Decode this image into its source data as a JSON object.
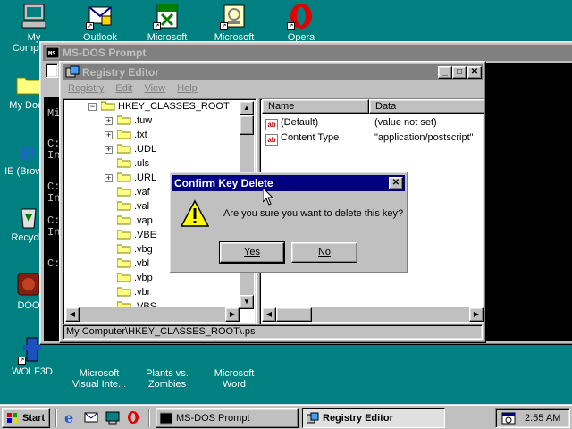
{
  "desktop": {
    "icons": [
      {
        "label": "My Computer"
      },
      {
        "label": "Outlook"
      },
      {
        "label": "Microsoft"
      },
      {
        "label": "Microsoft"
      },
      {
        "label": "Opera"
      },
      {
        "label": "My Docu"
      },
      {
        "label": "IE (Browse"
      },
      {
        "label": "Recycle"
      },
      {
        "label": "DOO"
      },
      {
        "label": "WOLF3D"
      },
      {
        "label": "Microsoft Visual Inte..."
      },
      {
        "label": "Plants vs. Zombies"
      },
      {
        "label": "Microsoft Word"
      }
    ]
  },
  "dos_window": {
    "title": "MS-DOS Prompt",
    "lines": [
      "Mi",
      "C:",
      "In",
      "C:",
      "In",
      "C:",
      "In",
      "C:"
    ]
  },
  "regedit": {
    "title": "Registry Editor",
    "menu": [
      "Registry",
      "Edit",
      "View",
      "Help"
    ],
    "tree_root": "HKEY_CLASSES_ROOT",
    "tree_items": [
      {
        "label": ".tuw",
        "expandable": true
      },
      {
        "label": ".txt",
        "expandable": true
      },
      {
        "label": ".UDL",
        "expandable": true
      },
      {
        "label": ".uls",
        "expandable": false
      },
      {
        "label": ".URL",
        "expandable": true
      },
      {
        "label": ".vaf",
        "expandable": false
      },
      {
        "label": ".val",
        "expandable": false
      },
      {
        "label": ".vap",
        "expandable": false
      },
      {
        "label": ".VBE",
        "expandable": false
      },
      {
        "label": ".vbg",
        "expandable": false
      },
      {
        "label": ".vbl",
        "expandable": false
      },
      {
        "label": ".vbp",
        "expandable": false
      },
      {
        "label": ".vbr",
        "expandable": false
      },
      {
        "label": ".VBS",
        "expandable": false
      }
    ],
    "columns": {
      "name": "Name",
      "data": "Data"
    },
    "values": [
      {
        "name": "(Default)",
        "data": "(value not set)"
      },
      {
        "name": "Content Type",
        "data": "\"application/postscript\""
      }
    ],
    "status": "My Computer\\HKEY_CLASSES_ROOT\\.ps"
  },
  "dialog": {
    "title": "Confirm Key Delete",
    "message": "Are you sure you want to delete this key?",
    "yes_label": "Yes",
    "no_label": "No"
  },
  "taskbar": {
    "start_label": "Start",
    "tasks": [
      {
        "label": "MS-DOS Prompt"
      },
      {
        "label": "Registry Editor"
      }
    ],
    "clock": "2:55 AM"
  },
  "colors": {
    "desktop": "#008080",
    "title_active": "#000080",
    "title_inactive": "#808080",
    "face": "#c0c0c0"
  }
}
